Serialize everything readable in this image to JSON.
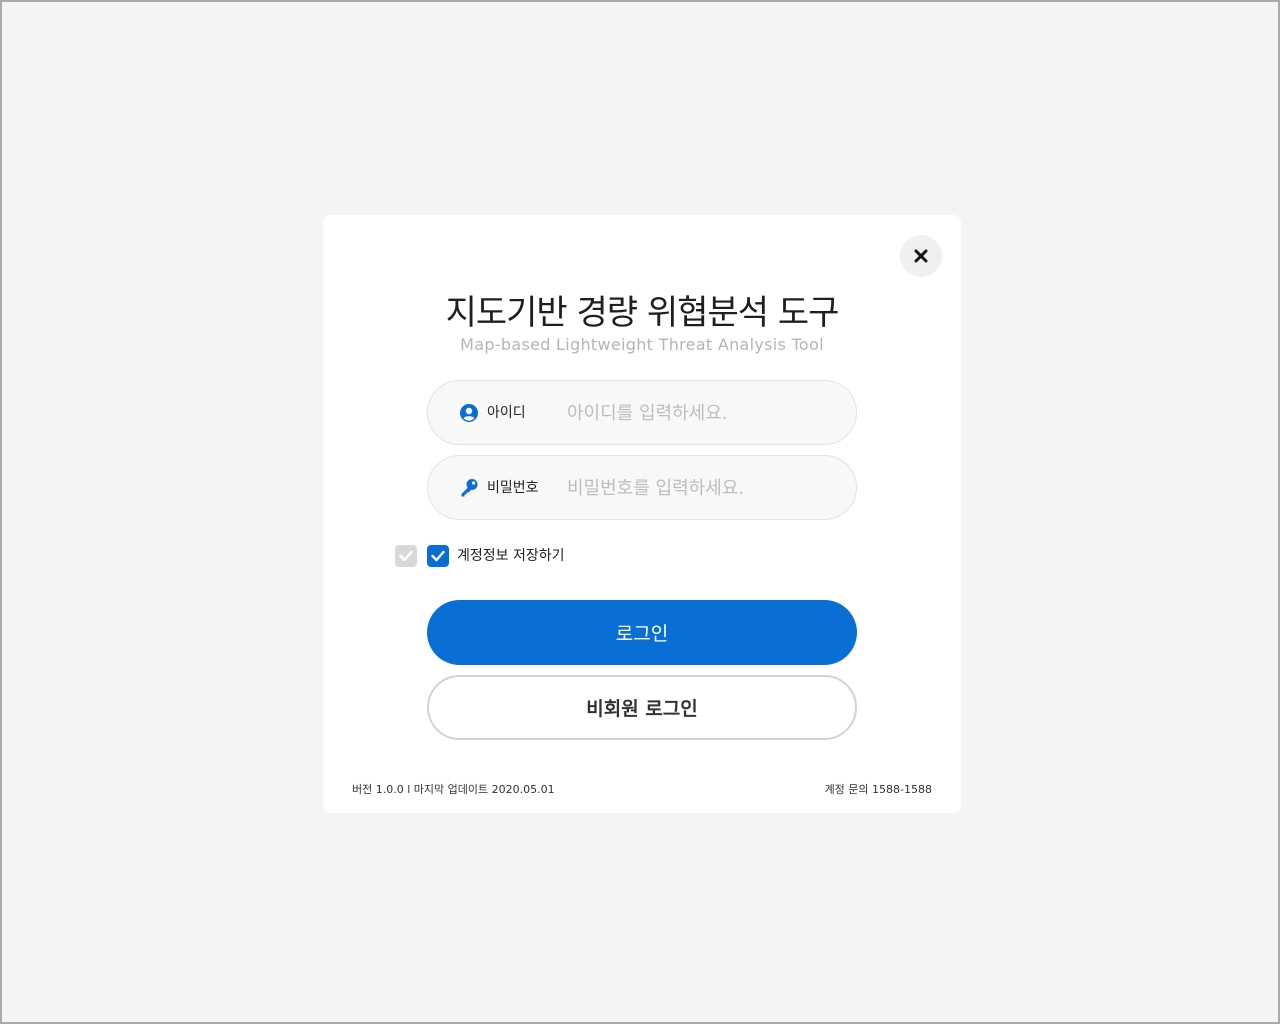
{
  "dialog": {
    "title": "지도기반 경량 위협분석 도구",
    "subtitle": "Map-based Lightweight Threat Analysis Tool",
    "close_icon": "close-icon"
  },
  "id_field": {
    "icon": "user-circle-icon",
    "label": "아이디",
    "placeholder": "아이디를 입력하세요.",
    "value": ""
  },
  "password_field": {
    "icon": "key-icon",
    "label": "비밀번호",
    "placeholder": "비밀번호를 입력하세요.",
    "value": ""
  },
  "remember": {
    "label": "계정정보 저장하기",
    "checked": true
  },
  "buttons": {
    "login": "로그인",
    "guest_login": "비회원 로그인"
  },
  "footer": {
    "version_info": "버전 1.0.0 l 마지막 업데이트 2020.05.01",
    "contact": "계정 문의 1588-1588"
  },
  "colors": {
    "accent": "#0a6fd4",
    "background": "#f4f4f4",
    "modal": "#ffffff"
  }
}
